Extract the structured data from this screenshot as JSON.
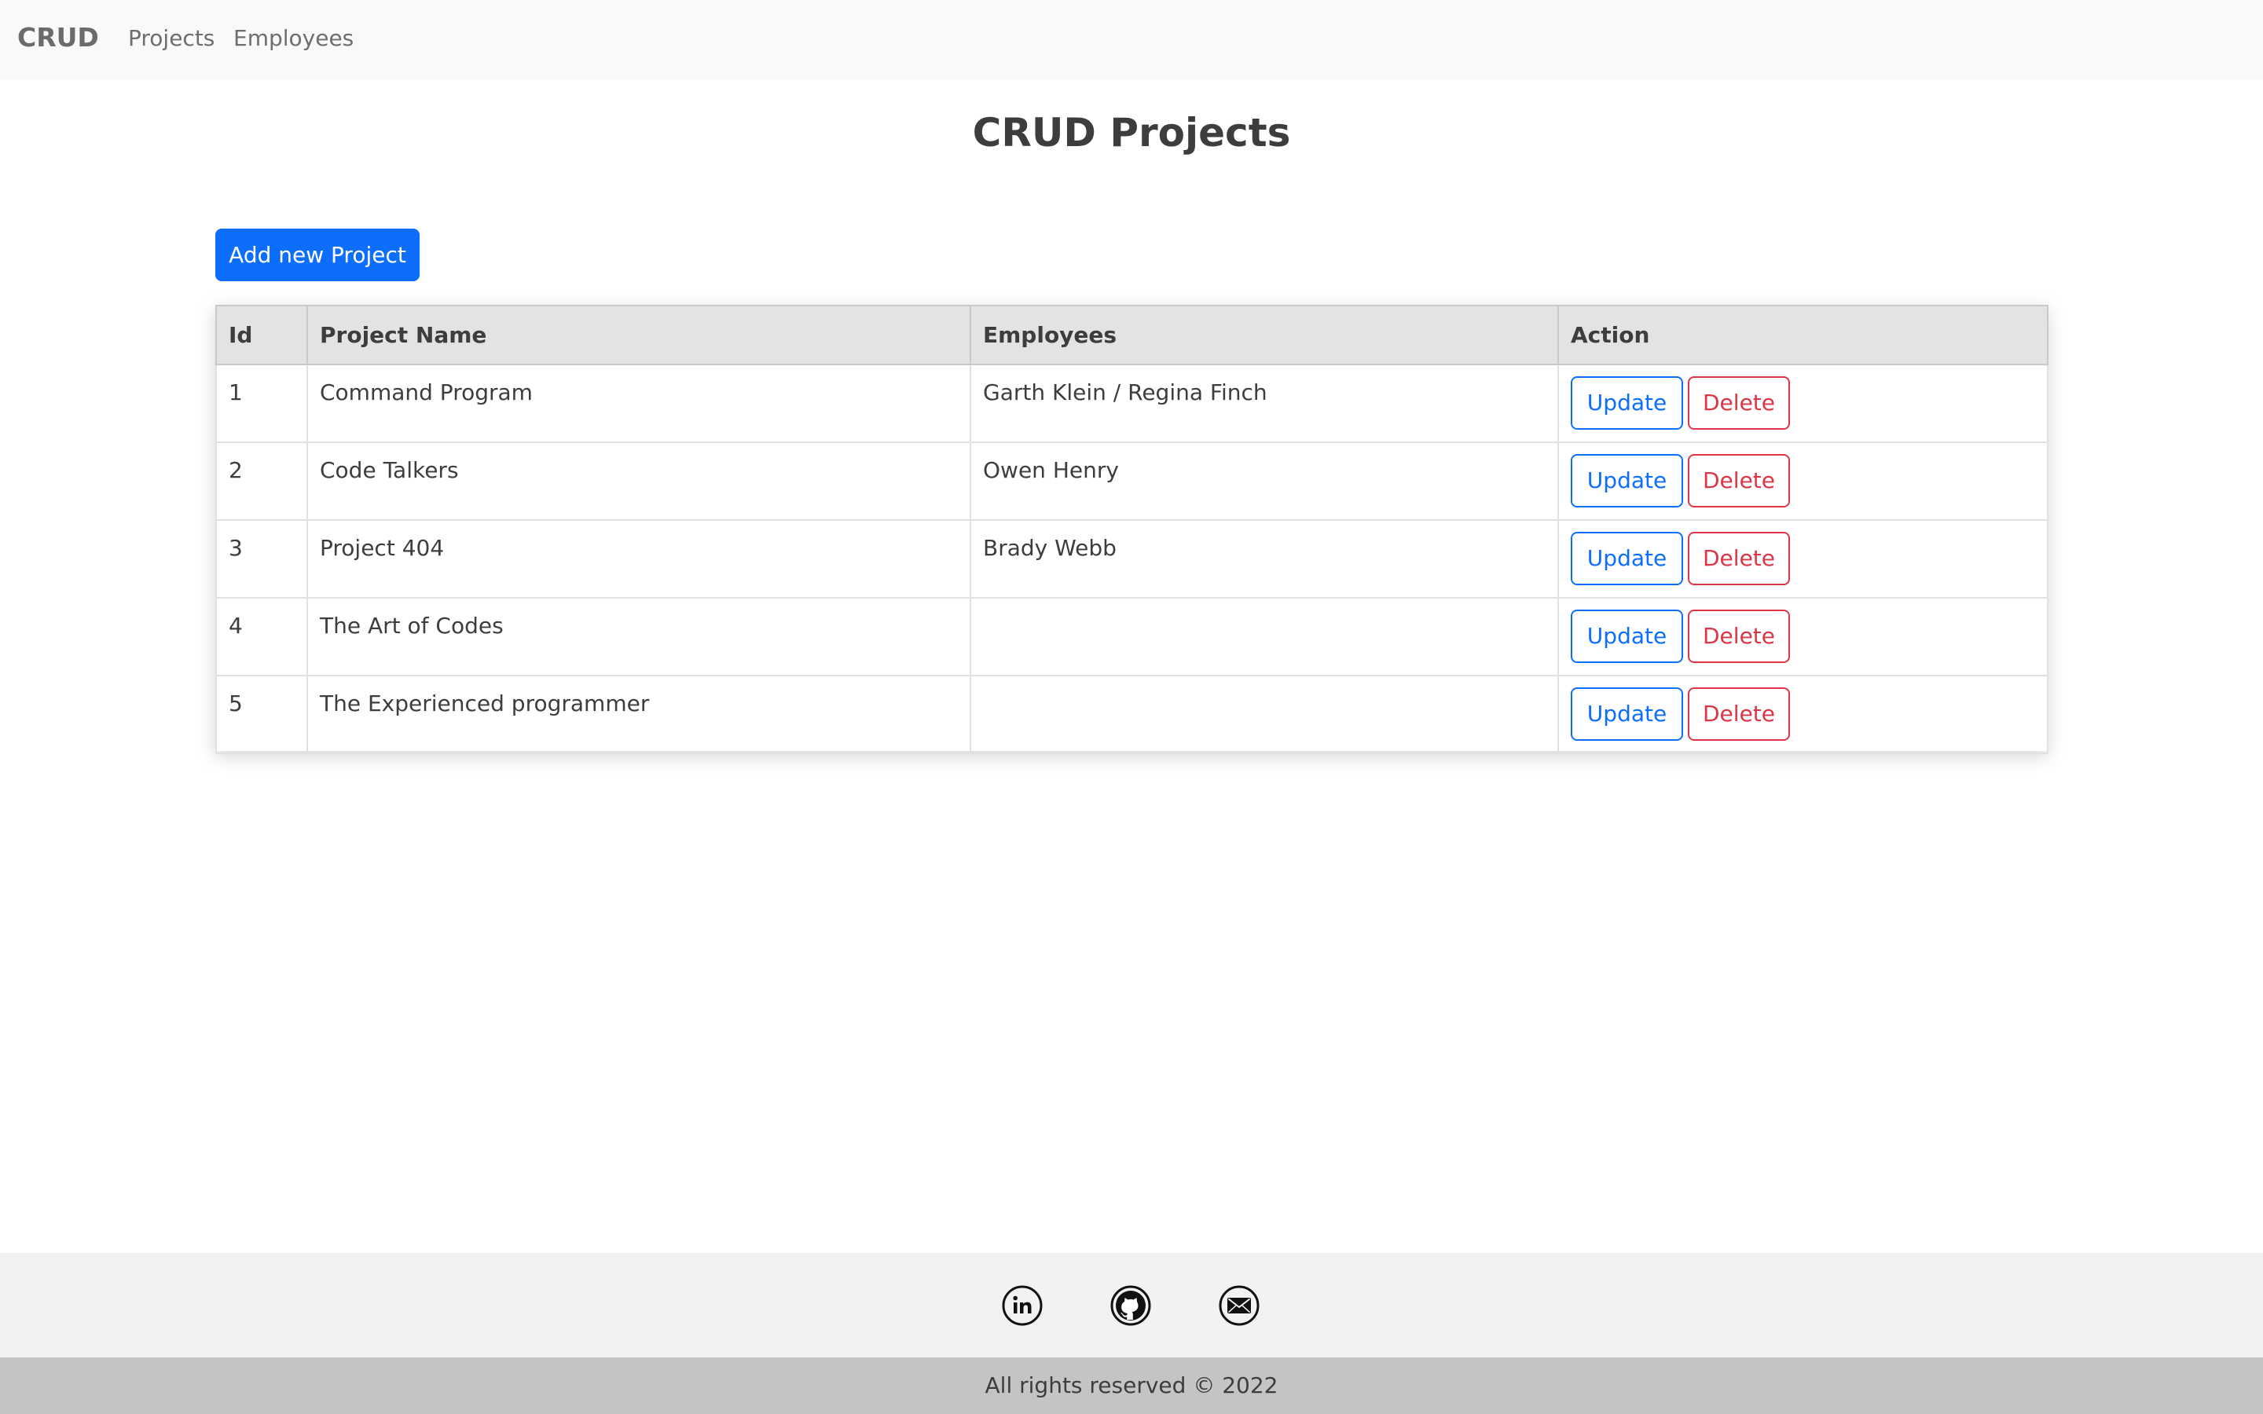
{
  "navbar": {
    "brand": "CRUD",
    "links": [
      "Projects",
      "Employees"
    ]
  },
  "main": {
    "title": "CRUD Projects",
    "add_button": "Add new Project",
    "table": {
      "headers": [
        "Id",
        "Project Name",
        "Employees",
        "Action"
      ],
      "rows": [
        {
          "id": "1",
          "name": "Command Program",
          "employees": "Garth Klein / Regina Finch"
        },
        {
          "id": "2",
          "name": "Code Talkers",
          "employees": "Owen Henry"
        },
        {
          "id": "3",
          "name": "Project 404",
          "employees": "Brady Webb"
        },
        {
          "id": "4",
          "name": "The Art of Codes",
          "employees": ""
        },
        {
          "id": "5",
          "name": "The Experienced programmer",
          "employees": ""
        }
      ],
      "update_label": "Update",
      "delete_label": "Delete"
    }
  },
  "footer": {
    "social_icons": [
      "linkedin-icon",
      "github-icon",
      "mail-icon"
    ],
    "copyright": "All rights reserved © 2022"
  },
  "colors": {
    "primary": "#0d6efd",
    "danger": "#dc3545",
    "navbar_bg": "#f8f9fa",
    "header_bg": "#e2e3e5",
    "footer_bg": "#f2f2f2",
    "footer_bottom_bg": "#c4c4c4"
  }
}
